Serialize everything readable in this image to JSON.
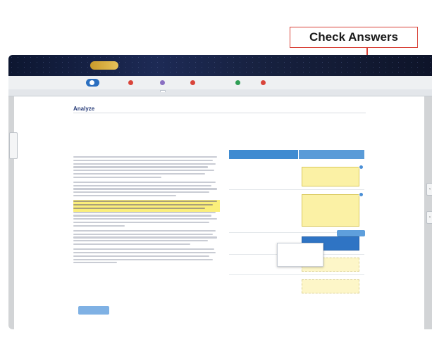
{
  "callout": {
    "label": "Check Answers"
  },
  "app": {
    "logo_text": "",
    "title": "",
    "user": ""
  },
  "steps": [
    {
      "label": "",
      "color": "#ffffff",
      "active": true
    },
    {
      "label": "",
      "color": "#d9443a",
      "active": false
    },
    {
      "label": "",
      "color": "#8a6fc2",
      "active": false
    },
    {
      "label": "",
      "color": "#d9443a",
      "active": false
    },
    {
      "label": "",
      "color": "#2f9e55",
      "active": false
    },
    {
      "label": "",
      "color": "#d9443a",
      "active": false
    }
  ],
  "subtabs": [
    {
      "label": ""
    },
    {
      "label": ""
    },
    {
      "label": ""
    },
    {
      "label": ""
    },
    {
      "label": ""
    }
  ],
  "page": {
    "heading": "Analyze",
    "instructions": "",
    "story_title": ""
  },
  "table": {
    "headers": [
      "",
      ""
    ],
    "rows": [
      {
        "question": "",
        "answer": "",
        "state": "filled"
      },
      {
        "question": "",
        "answer": "",
        "state": "filled"
      },
      {
        "question": "",
        "answer": "",
        "state": "selected"
      },
      {
        "question": "",
        "answer": "",
        "state": "empty"
      },
      {
        "question": "",
        "answer": "",
        "state": "empty"
      }
    ]
  },
  "tooltip": {
    "text": ""
  },
  "buttons": {
    "check_answers": "",
    "previous": ""
  },
  "side_tab": {
    "label": ""
  },
  "colors": {
    "accent": "#2b6fc0",
    "callout": "#d9443a",
    "card": "#fbf1a5",
    "header": "#3f8bd1"
  }
}
